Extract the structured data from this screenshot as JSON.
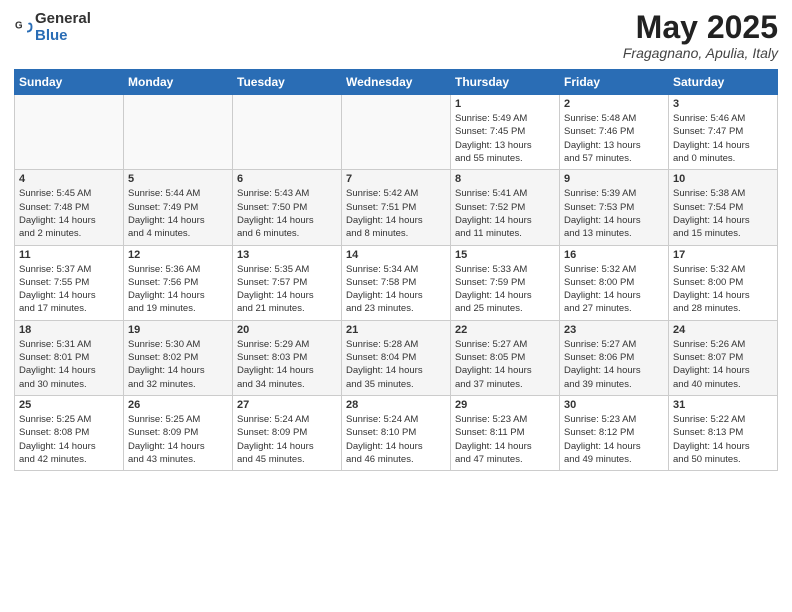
{
  "header": {
    "logo_general": "General",
    "logo_blue": "Blue",
    "title": "May 2025",
    "subtitle": "Fragagnano, Apulia, Italy"
  },
  "weekdays": [
    "Sunday",
    "Monday",
    "Tuesday",
    "Wednesday",
    "Thursday",
    "Friday",
    "Saturday"
  ],
  "weeks": [
    [
      {
        "day": "",
        "info": ""
      },
      {
        "day": "",
        "info": ""
      },
      {
        "day": "",
        "info": ""
      },
      {
        "day": "",
        "info": ""
      },
      {
        "day": "1",
        "info": "Sunrise: 5:49 AM\nSunset: 7:45 PM\nDaylight: 13 hours\nand 55 minutes."
      },
      {
        "day": "2",
        "info": "Sunrise: 5:48 AM\nSunset: 7:46 PM\nDaylight: 13 hours\nand 57 minutes."
      },
      {
        "day": "3",
        "info": "Sunrise: 5:46 AM\nSunset: 7:47 PM\nDaylight: 14 hours\nand 0 minutes."
      }
    ],
    [
      {
        "day": "4",
        "info": "Sunrise: 5:45 AM\nSunset: 7:48 PM\nDaylight: 14 hours\nand 2 minutes."
      },
      {
        "day": "5",
        "info": "Sunrise: 5:44 AM\nSunset: 7:49 PM\nDaylight: 14 hours\nand 4 minutes."
      },
      {
        "day": "6",
        "info": "Sunrise: 5:43 AM\nSunset: 7:50 PM\nDaylight: 14 hours\nand 6 minutes."
      },
      {
        "day": "7",
        "info": "Sunrise: 5:42 AM\nSunset: 7:51 PM\nDaylight: 14 hours\nand 8 minutes."
      },
      {
        "day": "8",
        "info": "Sunrise: 5:41 AM\nSunset: 7:52 PM\nDaylight: 14 hours\nand 11 minutes."
      },
      {
        "day": "9",
        "info": "Sunrise: 5:39 AM\nSunset: 7:53 PM\nDaylight: 14 hours\nand 13 minutes."
      },
      {
        "day": "10",
        "info": "Sunrise: 5:38 AM\nSunset: 7:54 PM\nDaylight: 14 hours\nand 15 minutes."
      }
    ],
    [
      {
        "day": "11",
        "info": "Sunrise: 5:37 AM\nSunset: 7:55 PM\nDaylight: 14 hours\nand 17 minutes."
      },
      {
        "day": "12",
        "info": "Sunrise: 5:36 AM\nSunset: 7:56 PM\nDaylight: 14 hours\nand 19 minutes."
      },
      {
        "day": "13",
        "info": "Sunrise: 5:35 AM\nSunset: 7:57 PM\nDaylight: 14 hours\nand 21 minutes."
      },
      {
        "day": "14",
        "info": "Sunrise: 5:34 AM\nSunset: 7:58 PM\nDaylight: 14 hours\nand 23 minutes."
      },
      {
        "day": "15",
        "info": "Sunrise: 5:33 AM\nSunset: 7:59 PM\nDaylight: 14 hours\nand 25 minutes."
      },
      {
        "day": "16",
        "info": "Sunrise: 5:32 AM\nSunset: 8:00 PM\nDaylight: 14 hours\nand 27 minutes."
      },
      {
        "day": "17",
        "info": "Sunrise: 5:32 AM\nSunset: 8:00 PM\nDaylight: 14 hours\nand 28 minutes."
      }
    ],
    [
      {
        "day": "18",
        "info": "Sunrise: 5:31 AM\nSunset: 8:01 PM\nDaylight: 14 hours\nand 30 minutes."
      },
      {
        "day": "19",
        "info": "Sunrise: 5:30 AM\nSunset: 8:02 PM\nDaylight: 14 hours\nand 32 minutes."
      },
      {
        "day": "20",
        "info": "Sunrise: 5:29 AM\nSunset: 8:03 PM\nDaylight: 14 hours\nand 34 minutes."
      },
      {
        "day": "21",
        "info": "Sunrise: 5:28 AM\nSunset: 8:04 PM\nDaylight: 14 hours\nand 35 minutes."
      },
      {
        "day": "22",
        "info": "Sunrise: 5:27 AM\nSunset: 8:05 PM\nDaylight: 14 hours\nand 37 minutes."
      },
      {
        "day": "23",
        "info": "Sunrise: 5:27 AM\nSunset: 8:06 PM\nDaylight: 14 hours\nand 39 minutes."
      },
      {
        "day": "24",
        "info": "Sunrise: 5:26 AM\nSunset: 8:07 PM\nDaylight: 14 hours\nand 40 minutes."
      }
    ],
    [
      {
        "day": "25",
        "info": "Sunrise: 5:25 AM\nSunset: 8:08 PM\nDaylight: 14 hours\nand 42 minutes."
      },
      {
        "day": "26",
        "info": "Sunrise: 5:25 AM\nSunset: 8:09 PM\nDaylight: 14 hours\nand 43 minutes."
      },
      {
        "day": "27",
        "info": "Sunrise: 5:24 AM\nSunset: 8:09 PM\nDaylight: 14 hours\nand 45 minutes."
      },
      {
        "day": "28",
        "info": "Sunrise: 5:24 AM\nSunset: 8:10 PM\nDaylight: 14 hours\nand 46 minutes."
      },
      {
        "day": "29",
        "info": "Sunrise: 5:23 AM\nSunset: 8:11 PM\nDaylight: 14 hours\nand 47 minutes."
      },
      {
        "day": "30",
        "info": "Sunrise: 5:23 AM\nSunset: 8:12 PM\nDaylight: 14 hours\nand 49 minutes."
      },
      {
        "day": "31",
        "info": "Sunrise: 5:22 AM\nSunset: 8:13 PM\nDaylight: 14 hours\nand 50 minutes."
      }
    ]
  ]
}
